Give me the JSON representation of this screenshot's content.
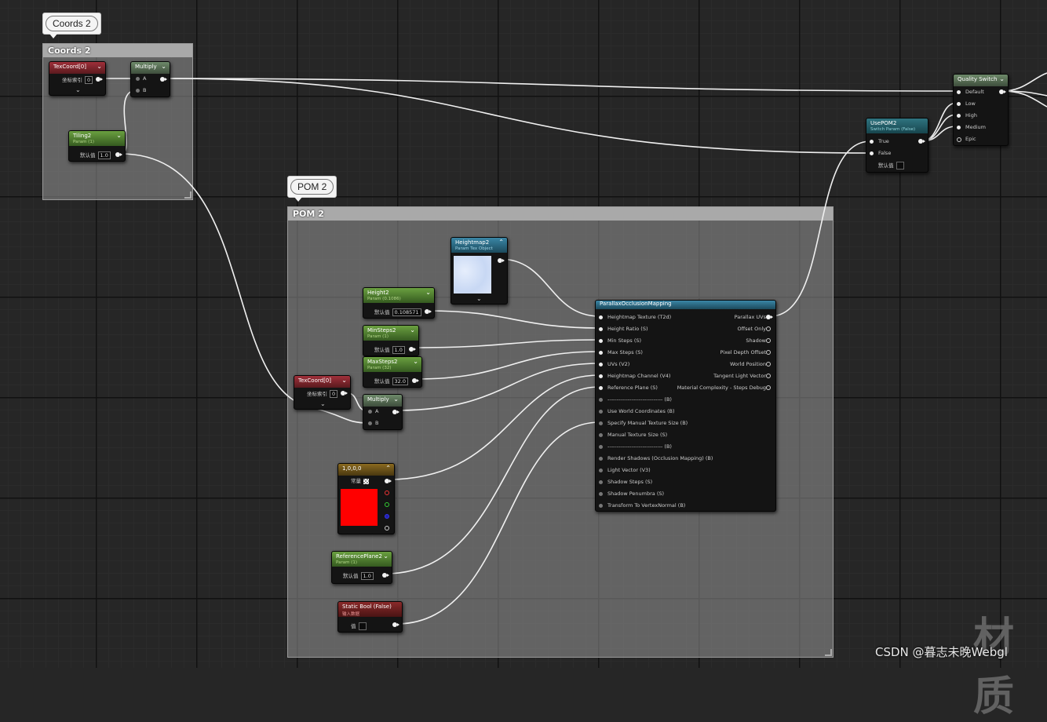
{
  "comments": {
    "coords": {
      "bubble": "Coords 2",
      "title": "Coords 2"
    },
    "pom": {
      "bubble": "POM 2",
      "title": "POM 2"
    }
  },
  "nodes": {
    "texcoord_a": {
      "title": "TexCoord[0]",
      "field_label": "坐标索引",
      "field_value": "0"
    },
    "multiply_a": {
      "title": "Multiply",
      "pin_a": "A",
      "pin_b": "B"
    },
    "tiling": {
      "title": "Tiling2",
      "subtitle": "Param (1)",
      "field_label": "默认值",
      "field_value": "1.0"
    },
    "quality_switch": {
      "title": "Quality Switch",
      "pins": [
        "Default",
        "Low",
        "High",
        "Medium",
        "Epic"
      ]
    },
    "usepom": {
      "title": "UsePOM2",
      "subtitle": "Switch Param (False)",
      "pin_true": "True",
      "pin_false": "False",
      "field_label": "默认值"
    },
    "heightmap": {
      "title": "Heightmap2",
      "subtitle": "Param Tex Object"
    },
    "height": {
      "title": "Height2",
      "subtitle": "Param (0.1086)",
      "field_label": "默认值",
      "field_value": "0.108571"
    },
    "minsteps": {
      "title": "MinSteps2",
      "subtitle": "Param (1)",
      "field_label": "默认值",
      "field_value": "1.0"
    },
    "maxsteps": {
      "title": "MaxSteps2",
      "subtitle": "Param (32)",
      "field_label": "默认值",
      "field_value": "32.0"
    },
    "texcoord_b": {
      "title": "TexCoord[0]",
      "field_label": "坐标索引",
      "field_value": "0"
    },
    "multiply_b": {
      "title": "Multiply",
      "pin_a": "A",
      "pin_b": "B"
    },
    "constant": {
      "title": "1,0,0,0",
      "field_label": "常量",
      "color": "#ff0000"
    },
    "refplane": {
      "title": "ReferencePlane2",
      "subtitle": "Param (1)",
      "field_label": "默认值",
      "field_value": "1.0"
    },
    "staticbool": {
      "title": "Static Bool (False)",
      "subtitle": "输入数据",
      "field_label": "值"
    },
    "pom": {
      "title": "ParallaxOcclusionMapping",
      "inputs": [
        "Heightmap Texture (T2d)",
        "Height Ratio (S)",
        "Min Steps (S)",
        "Max Steps (S)",
        "UVs (V2)",
        "Heightmap Channel (V4)",
        "Reference Plane (S)",
        "------------------------------ (B)",
        "Use World Coordinates (B)",
        "Specify Manual Texture Size (B)",
        "Manual Texture Size (S)",
        "------------------------------ (B)",
        "Render Shadows (Occlusion Mapping) (B)",
        "Light Vector (V3)",
        "Shadow Steps (S)",
        "Shadow Penumbra (S)",
        "Transform To VertexNormal (B)"
      ],
      "outputs": [
        "Parallax UVs",
        "Offset Only",
        "Shadow",
        "Pixel Depth Offset",
        "World Position",
        "Tangent Light Vector",
        "Material Complexity - Steps Debug"
      ]
    }
  },
  "watermark": "CSDN @暮志未晚Webgl",
  "corner_glyph": "材质",
  "colors": {
    "canvas": "#262626",
    "wire": "#f0f0f0",
    "red_preview": "#ff0000"
  }
}
